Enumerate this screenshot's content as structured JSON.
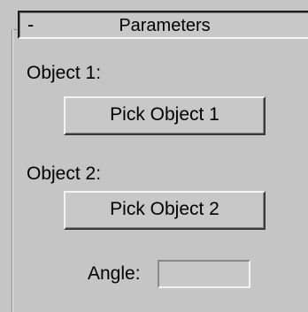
{
  "rollout": {
    "collapse_symbol": "-",
    "title": "Parameters"
  },
  "object1": {
    "label": "Object 1:",
    "button_label": "Pick Object 1"
  },
  "object2": {
    "label": "Object 2:",
    "button_label": "Pick Object 2"
  },
  "angle": {
    "label": "Angle:",
    "value": ""
  },
  "colors": {
    "panel_background": "#c5c5c5",
    "text": "#000000"
  }
}
